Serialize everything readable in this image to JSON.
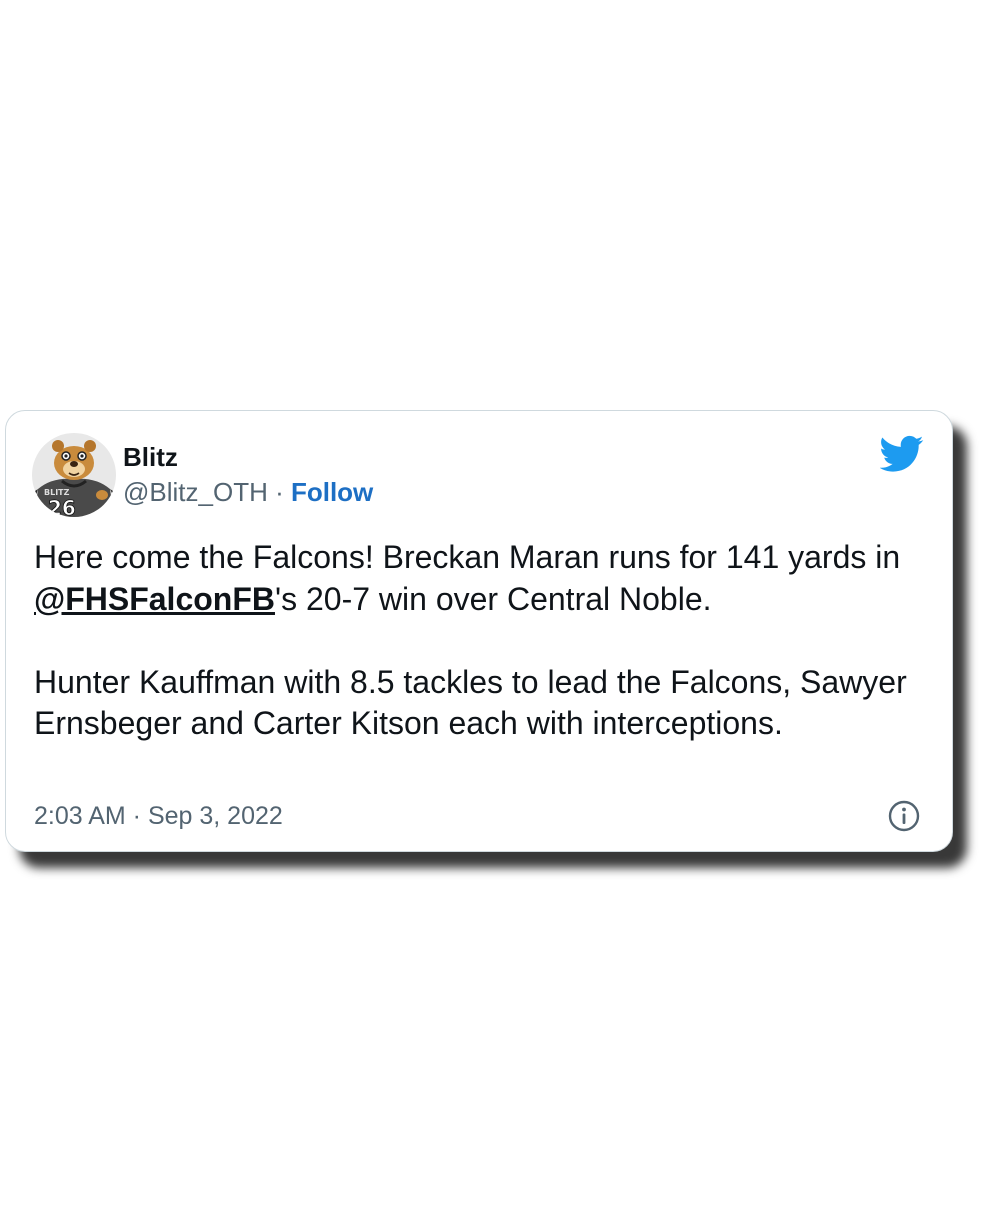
{
  "tweet": {
    "author_name": "Blitz",
    "author_handle": "@Blitz_OTH",
    "separator": " · ",
    "follow_label": "Follow",
    "body_line1_prefix": "Here come the Falcons! Breckan Maran runs for 141 yards in ",
    "mention": "@FHSFalconFB",
    "body_line1_suffix": "'s 20-7 win over Central Noble.",
    "body_paragraph2": "Hunter Kauffman with 8.5 tackles to lead the Falcons, Sawyer Ernsbeger and Carter Kitson each with interceptions.",
    "time": "2:03 AM",
    "date": "Sep 3, 2022",
    "avatar_jersey_text": "BLITZ",
    "avatar_jersey_number": "26"
  },
  "icons": {
    "brand": "twitter-bird-icon",
    "info": "info-icon"
  },
  "colors": {
    "twitter_blue": "#1d9bf0",
    "follow_blue": "#1d6fc4",
    "text_primary": "#0f1419",
    "text_secondary": "#536471"
  }
}
